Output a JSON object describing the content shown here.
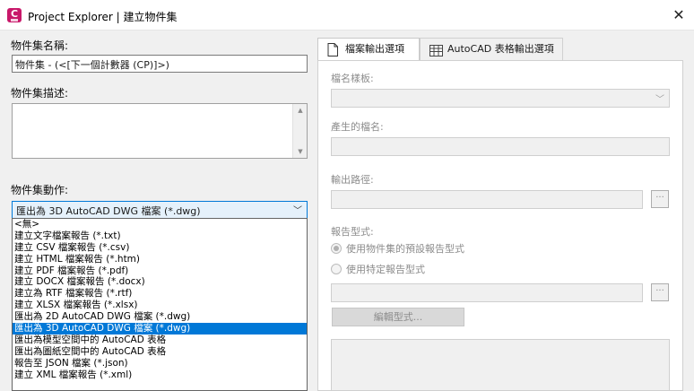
{
  "window": {
    "title": "Project Explorer | 建立物件集",
    "app_icon_letter": "C",
    "close_glyph": "✕"
  },
  "left": {
    "name_label": "物件集名稱:",
    "name_value": "物件集 - (<[下一個計數器 (CP)]>)",
    "desc_label": "物件集描述:",
    "desc_value": "",
    "action_label": "物件集動作:",
    "action_selected": "匯出為 3D AutoCAD DWG 檔案 (*.dwg)",
    "action_options": [
      "<無>",
      "建立文字檔案報告 (*.txt)",
      "建立 CSV 檔案報告 (*.csv)",
      "建立 HTML 檔案報告 (*.htm)",
      "建立 PDF 檔案報告 (*.pdf)",
      "建立 DOCX 檔案報告 (*.docx)",
      "建立為 RTF 檔案報告 (*.rtf)",
      "建立 XLSX 檔案報告 (*.xlsx)",
      "匯出為 2D AutoCAD DWG 檔案 (*.dwg)",
      "匯出為 3D AutoCAD DWG 檔案 (*.dwg)",
      "匯出為模型空間中的 AutoCAD 表格",
      "匯出為圖紙空間中的 AutoCAD 表格",
      "報告至 JSON 檔案 (*.json)",
      "建立 XML 檔案報告 (*.xml)"
    ],
    "selected_index": 9
  },
  "tabs": [
    {
      "label": "檔案輸出選項",
      "icon": "file-icon",
      "active": true
    },
    {
      "label": "AutoCAD 表格輸出選項",
      "icon": "table-icon",
      "active": false
    }
  ],
  "output": {
    "template_label": "檔名樣板:",
    "template_value": "",
    "generated_label": "產生的檔名:",
    "generated_value": "",
    "path_label": "輸出路徑:",
    "path_value": "",
    "browse_glyph": "···",
    "report_type_label": "報告型式:",
    "radio_default_label": "使用物件集的預設報告型式",
    "radio_specific_label": "使用特定報告型式",
    "radio_default_checked": true,
    "edit_button_label": "編輯型式..."
  }
}
